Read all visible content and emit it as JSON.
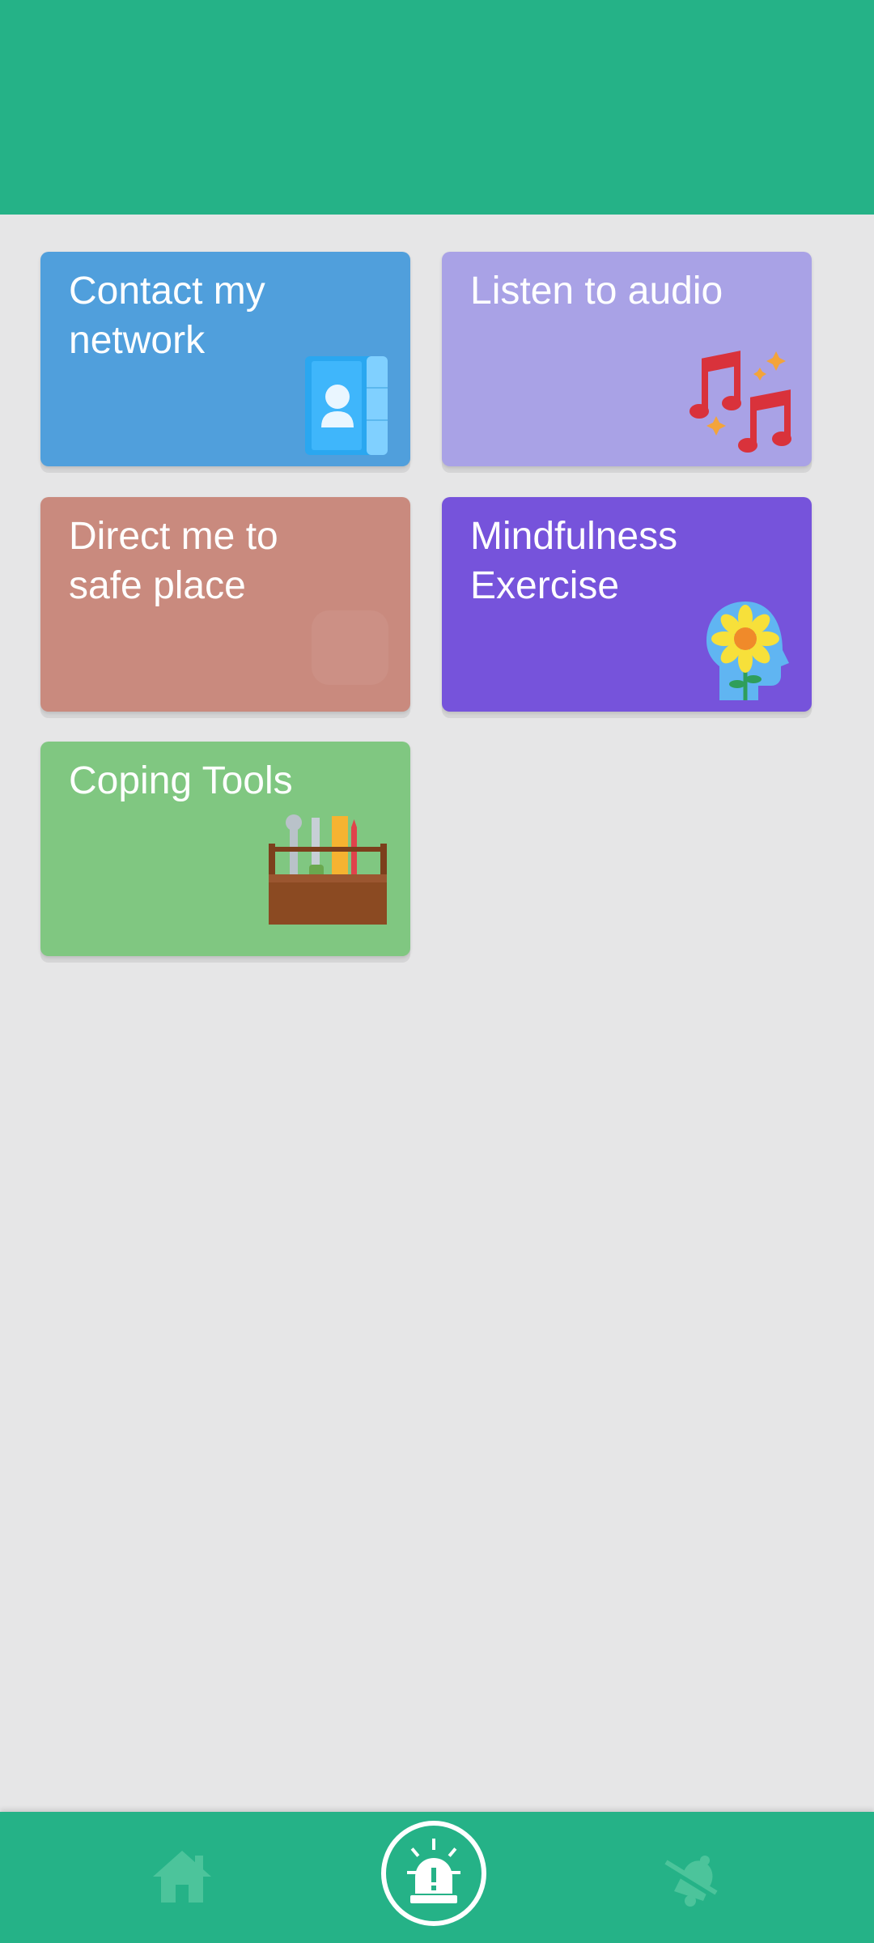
{
  "colors": {
    "brand": "#25b287",
    "background": "#e6e6e7",
    "contact_tile": "#509fdc",
    "audio_tile": "#a9a2e6",
    "safe_tile": "#c98a7e",
    "mind_tile": "#7653db",
    "coping_tile": "#80c781"
  },
  "tiles": [
    {
      "label": "Contact my\nnetwork",
      "icon": "contact-book-icon"
    },
    {
      "label": "Listen to audio",
      "icon": "music-notes-icon"
    },
    {
      "label": "Direct me to\nsafe place",
      "icon": "map-pin-icon"
    },
    {
      "label": "Mindfulness\nExercise",
      "icon": "mind-flower-icon"
    },
    {
      "label": "Coping Tools",
      "icon": "toolbox-icon"
    }
  ],
  "bottom_nav": {
    "items": [
      {
        "icon": "home-icon",
        "active": false
      },
      {
        "icon": "alarm-siren-icon",
        "active": true
      },
      {
        "icon": "bell-off-icon",
        "active": false
      }
    ]
  }
}
